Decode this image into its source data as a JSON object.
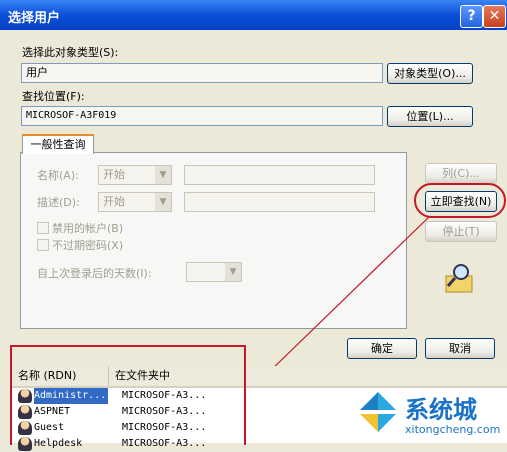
{
  "window": {
    "title": "选择用户",
    "help_glyph": "?",
    "close_glyph": "✕"
  },
  "object_type": {
    "label": "选择此对象类型(S):",
    "value": "用户",
    "button": "对象类型(O)..."
  },
  "location": {
    "label": "查找位置(F):",
    "value": "MICROSOF-A3F019",
    "button": "位置(L)..."
  },
  "tab": {
    "label": "一般性查询"
  },
  "query": {
    "name_label": "名称(A):",
    "name_mode": "开始",
    "desc_label": "描述(D):",
    "desc_mode": "开始",
    "disabled_accounts": "禁用的帐户(B)",
    "no_expire_pwd": "不过期密码(X)",
    "days_since_login": "自上次登录后的天数(I):"
  },
  "side_buttons": {
    "columns": "列(C)...",
    "find_now": "立即查找(N)",
    "stop": "停止(T)"
  },
  "footer": {
    "ok": "确定",
    "cancel": "取消"
  },
  "results": {
    "headers": [
      "名称 (RDN)",
      "在文件夹中"
    ],
    "rows": [
      {
        "name": "Administr...",
        "folder": "MICROSOF-A3..."
      },
      {
        "name": "ASPNET",
        "folder": "MICROSOF-A3..."
      },
      {
        "name": "Guest",
        "folder": "MICROSOF-A3..."
      },
      {
        "name": "Helpdesk",
        "folder": "MICROSOF-A3..."
      }
    ]
  },
  "watermark": {
    "brand": "系统城",
    "url": "xitongcheng.com"
  },
  "colors": {
    "annotation_red": "#c4172a",
    "titlebar_blue": "#0a4fd6",
    "selection": "#316ac5"
  }
}
